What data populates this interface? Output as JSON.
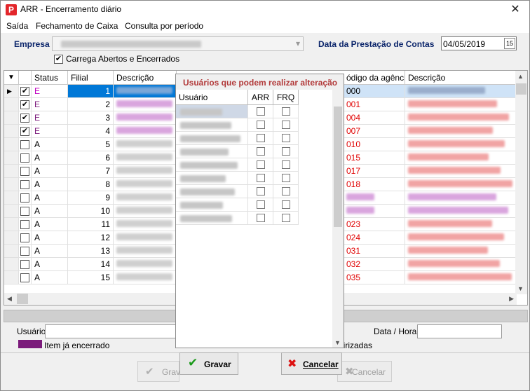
{
  "window": {
    "title": "ARR - Encerramento diário",
    "close_glyph": "✕",
    "app_icon_letter": "P"
  },
  "menu": [
    "Saída",
    "Fechamento de Caixa",
    "Consulta por período"
  ],
  "form": {
    "empresa_label": "Empresa",
    "empresa_dropdown_glyph": "▾",
    "data_label": "Data da Prestação de Contas",
    "data_value": "04/05/2019",
    "calendar_glyph": "15",
    "carrega_label": "Carrega Abertos e Encerrados",
    "carrega_checked": true
  },
  "grid": {
    "columns": [
      "Status",
      "Filial",
      "Descrição",
      "ódigo da agência",
      "Descrição"
    ],
    "row_indicator": "▶",
    "rows": [
      {
        "checked": true,
        "status": "E",
        "filial": "1",
        "agencia": "000",
        "selected": true
      },
      {
        "checked": true,
        "status": "E",
        "filial": "2",
        "agencia": "001"
      },
      {
        "checked": true,
        "status": "E",
        "filial": "3",
        "agencia": "004"
      },
      {
        "checked": true,
        "status": "E",
        "filial": "4",
        "agencia": "007"
      },
      {
        "checked": false,
        "status": "A",
        "filial": "5",
        "agencia": "010"
      },
      {
        "checked": false,
        "status": "A",
        "filial": "6",
        "agencia": "015"
      },
      {
        "checked": false,
        "status": "A",
        "filial": "7",
        "agencia": "017"
      },
      {
        "checked": false,
        "status": "A",
        "filial": "8",
        "agencia": "018"
      },
      {
        "checked": false,
        "status": "A",
        "filial": "9",
        "agencia": ""
      },
      {
        "checked": false,
        "status": "A",
        "filial": "10",
        "agencia": ""
      },
      {
        "checked": false,
        "status": "A",
        "filial": "11",
        "agencia": "023"
      },
      {
        "checked": false,
        "status": "A",
        "filial": "12",
        "agencia": "024"
      },
      {
        "checked": false,
        "status": "A",
        "filial": "13",
        "agencia": "031"
      },
      {
        "checked": false,
        "status": "A",
        "filial": "14",
        "agencia": "032"
      },
      {
        "checked": false,
        "status": "A",
        "filial": "15",
        "agencia": "035"
      }
    ],
    "scroll_up_glyph": "▲",
    "scroll_down_glyph": "▼",
    "scroll_left_glyph": "◀",
    "scroll_right_glyph": "▶"
  },
  "footer": {
    "usuario_label": "Usuário",
    "data_hora_label": "Data / Hora",
    "legend_encerrado": "Item já encerrado",
    "legend_partial": "eirizadas",
    "gravar_label": "Gravar",
    "cancelar_label": "Cancelar"
  },
  "popup": {
    "title": "Usuários que podem realizar alteração",
    "columns": [
      "Usuário",
      "ARR",
      "FRQ"
    ],
    "row_count": 9,
    "gravar_label": "Gravar",
    "cancelar_label": "Cancelar",
    "scroll_down_glyph": "▼"
  },
  "colors": {
    "encerrado": "#7b1a7b",
    "selected_row": "#0078d7",
    "popup_title": "#b23a3a",
    "agencia_red": "#e00000"
  }
}
